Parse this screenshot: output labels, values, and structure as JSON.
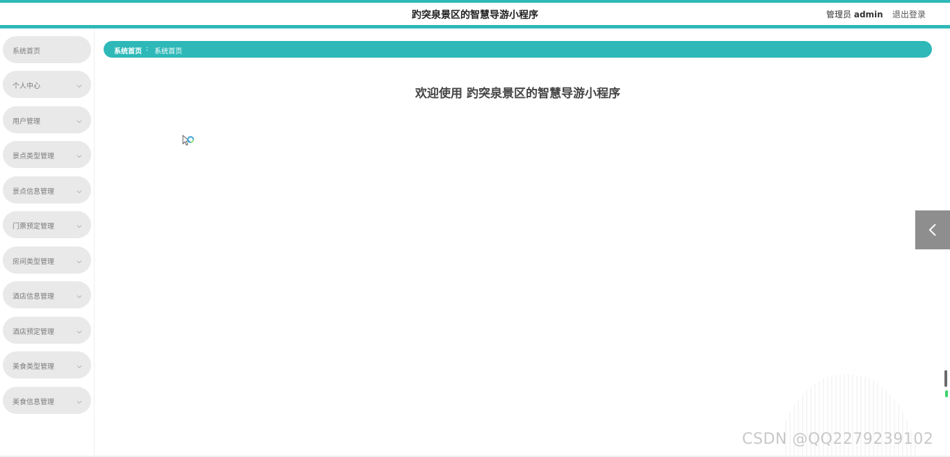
{
  "header": {
    "title": "趵突泉景区的智慧导游小程序",
    "user_prefix": "管理员",
    "username": "admin",
    "logout": "退出登录"
  },
  "colors": {
    "accent": "#2eb8b8",
    "menu_bg": "#e9e9e9"
  },
  "sidebar": {
    "items": [
      {
        "label": "系统首页",
        "has_arrow": false
      },
      {
        "label": "个人中心",
        "has_arrow": true
      },
      {
        "label": "用户管理",
        "has_arrow": true
      },
      {
        "label": "景点类型管理",
        "has_arrow": true
      },
      {
        "label": "景点信息管理",
        "has_arrow": true
      },
      {
        "label": "门票预定管理",
        "has_arrow": true
      },
      {
        "label": "房间类型管理",
        "has_arrow": true
      },
      {
        "label": "酒店信息管理",
        "has_arrow": true
      },
      {
        "label": "酒店预定管理",
        "has_arrow": true
      },
      {
        "label": "美食类型管理",
        "has_arrow": true
      },
      {
        "label": "美食信息管理",
        "has_arrow": true
      }
    ]
  },
  "breadcrumb": {
    "home": "系统首页",
    "separator": "ː",
    "current": "系统首页"
  },
  "main": {
    "welcome": "欢迎使用 趵突泉景区的智慧导游小程序"
  },
  "watermark": "CSDN @QQ2279239102",
  "icons": {
    "toggle": "chevron-left-icon",
    "menu_arrow": "chevron-down-icon"
  }
}
